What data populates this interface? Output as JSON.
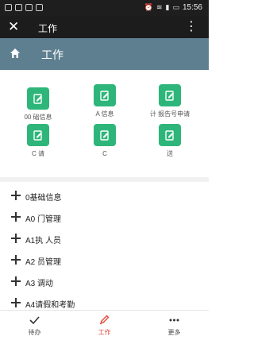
{
  "status_bar": {
    "time": "15:56"
  },
  "app_bar": {
    "title": "工作"
  },
  "header": {
    "title": "工作"
  },
  "grid": {
    "tiles": [
      {
        "label": "00 础信息"
      },
      {
        "label": "A 信息"
      },
      {
        "label": "计 报告号申请"
      },
      {
        "label": "C 请"
      },
      {
        "label": "C"
      },
      {
        "label": "送"
      }
    ]
  },
  "list": {
    "items": [
      {
        "label": "0基础信息"
      },
      {
        "label": "A0 门管理"
      },
      {
        "label": "A1执 人员"
      },
      {
        "label": "A2 员管理"
      },
      {
        "label": "A3 调动"
      },
      {
        "label": "A4请假和考勤"
      }
    ]
  },
  "tabs": [
    {
      "label": "待办",
      "icon": "check-icon",
      "active": false
    },
    {
      "label": "工作",
      "icon": "pencil-icon",
      "active": true,
      "color": "#e24a3b"
    },
    {
      "label": "更多",
      "icon": "more-dots-icon",
      "active": false
    }
  ],
  "colors": {
    "header_band": "#5e7f90",
    "tile_icon": "#2eb67a",
    "active_tab": "#e24a3b"
  }
}
